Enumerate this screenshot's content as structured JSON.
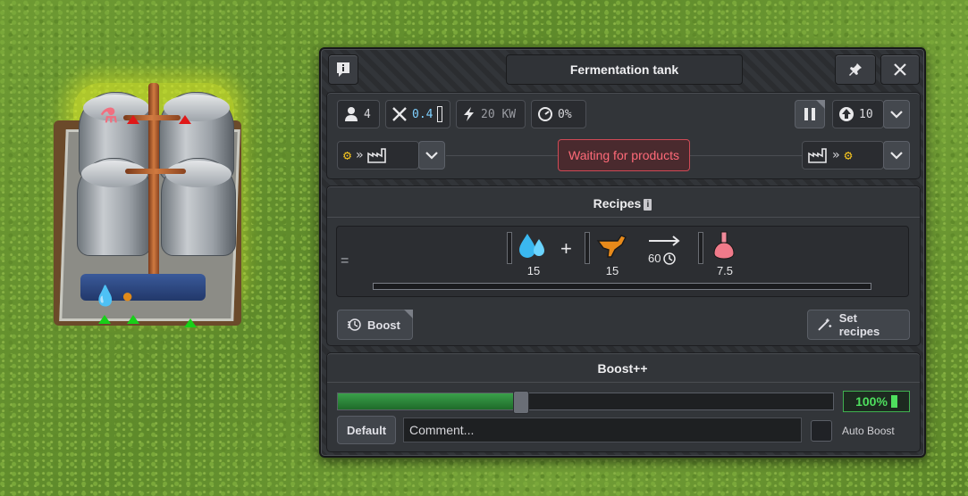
{
  "panel": {
    "title": "Fermentation tank",
    "stats": {
      "workers": "4",
      "maintenance": "0.4",
      "power": "20 KW",
      "efficiency": "0%"
    },
    "priority_value": "10",
    "status": "Waiting for products",
    "recipes_section": {
      "title": "Recipes",
      "info_glyph": "i",
      "row_marker": "=",
      "inputs": [
        {
          "icon": "water-icon",
          "amount": "15"
        },
        {
          "icon": "potato-icon",
          "amount": "15"
        }
      ],
      "operator": "+",
      "duration": "60",
      "outputs": [
        {
          "icon": "ethanol-icon",
          "amount": "7.5"
        }
      ]
    },
    "buttons": {
      "boost": "Boost",
      "set_recipes": "Set recipes"
    },
    "boost_section": {
      "title": "Boost++",
      "level_percent": 37,
      "percent_label": "100%",
      "default_button": "Default",
      "comment_value": "Comment...",
      "auto_boost_label": "Auto Boost",
      "auto_boost_checked": false
    }
  },
  "colors": {
    "status_text": "#ff6a78",
    "boost_green": "#4ee05e",
    "highlight": "#e6f028"
  }
}
